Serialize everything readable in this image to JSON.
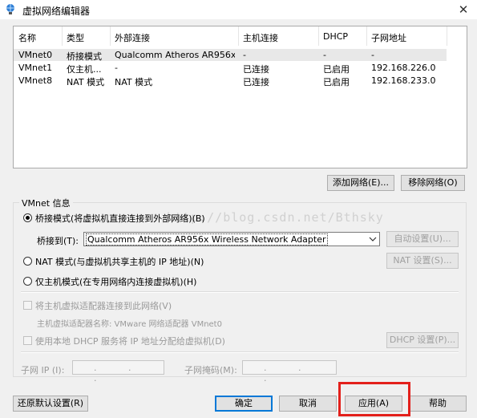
{
  "window": {
    "title": "虚拟网络编辑器",
    "close_glyph": "✕"
  },
  "table": {
    "columns": [
      "名称",
      "类型",
      "外部连接",
      "主机连接",
      "DHCP",
      "子网地址"
    ],
    "rows": [
      [
        "VMnet0",
        "桥接模式",
        "Qualcomm Atheros AR956x ...",
        "-",
        "-",
        "-"
      ],
      [
        "VMnet1",
        "仅主机...",
        "-",
        "已连接",
        "已启用",
        "192.168.226.0"
      ],
      [
        "VMnet8",
        "NAT 模式",
        "NAT 模式",
        "已连接",
        "已启用",
        "192.168.233.0"
      ]
    ],
    "selected_row": 0
  },
  "buttons": {
    "add_network": "添加网络(E)...",
    "remove_network": "移除网络(O)",
    "auto_settings": "自动设置(U)...",
    "nat_settings": "NAT 设置(S)...",
    "dhcp_settings": "DHCP 设置(P)...",
    "restore_defaults": "还原默认设置(R)",
    "ok": "确定",
    "cancel": "取消",
    "apply": "应用(A)",
    "help": "帮助"
  },
  "vmnet_info": {
    "group_label": "VMnet 信息",
    "bridged_label": "桥接模式(将虚拟机直接连接到外部网络)(B)",
    "bridged_to_label": "桥接到(T):",
    "bridged_to_value": "Qualcomm Atheros AR956x Wireless Network Adapter",
    "nat_label": "NAT 模式(与虚拟机共享主机的 IP 地址)(N)",
    "hostonly_label": "仅主机模式(在专用网络内连接虚拟机)(H)",
    "selected_mode": "bridged",
    "connect_adapter_label": "将主机虚拟适配器连接到此网络(V)",
    "adapter_name_label": "主机虚拟适配器名称: VMware 网络适配器 VMnet0",
    "use_dhcp_label": "使用本地 DHCP 服务将 IP 地址分配给虚拟机(D)",
    "subnet_ip_label": "子网 IP (I):",
    "subnet_ip_value": " .  .  . ",
    "subnet_mask_label": "子网掩码(M):",
    "subnet_mask_value": " .  .  . "
  },
  "watermark": "http://blog.csdn.net/Bthsky",
  "colors": {
    "highlight": "#e3201b",
    "accent": "#0078d7"
  }
}
